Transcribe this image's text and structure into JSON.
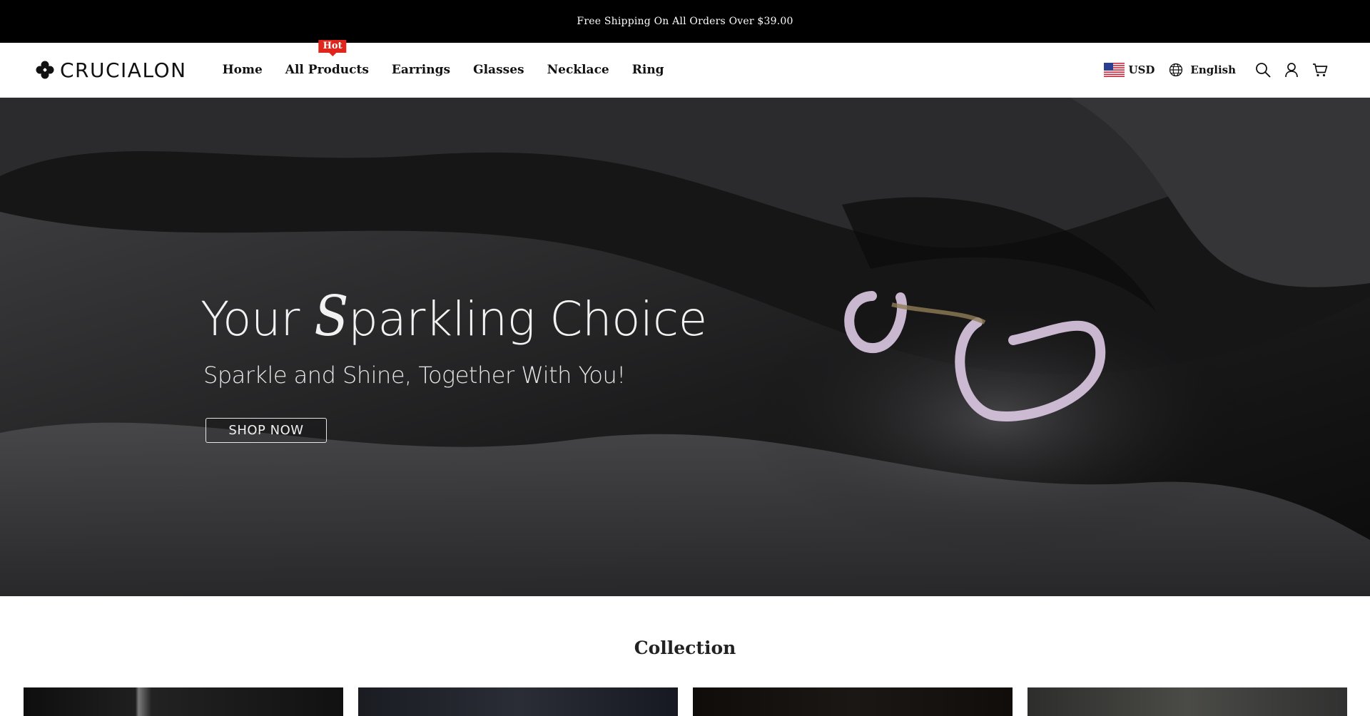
{
  "announcement": {
    "text": "Free Shipping On All Orders Over $39.00"
  },
  "header": {
    "logo_text": "CRUCIALON",
    "nav": [
      {
        "label": "Home"
      },
      {
        "label": "All Products",
        "badge": "Hot"
      },
      {
        "label": "Earrings"
      },
      {
        "label": "Glasses"
      },
      {
        "label": "Necklace"
      },
      {
        "label": "Ring"
      }
    ],
    "currency": "USD",
    "language": "English",
    "icons": [
      "search-icon",
      "account-icon",
      "cart-icon"
    ]
  },
  "hero": {
    "title_prefix": "Your ",
    "title_s": "S",
    "title_rest": "parkling Choice",
    "subtitle": "Sparkle and Shine, Together With You!",
    "button": "SHOP NOW"
  },
  "collection": {
    "title": "Collection",
    "cards": [
      {
        "color": "#1b1b1b"
      },
      {
        "color": "#20232b"
      },
      {
        "color": "#120f0d"
      },
      {
        "color": "#3a3b38"
      }
    ]
  },
  "colors": {
    "badge": "#e0261c",
    "announcement_bg": "#000000"
  }
}
